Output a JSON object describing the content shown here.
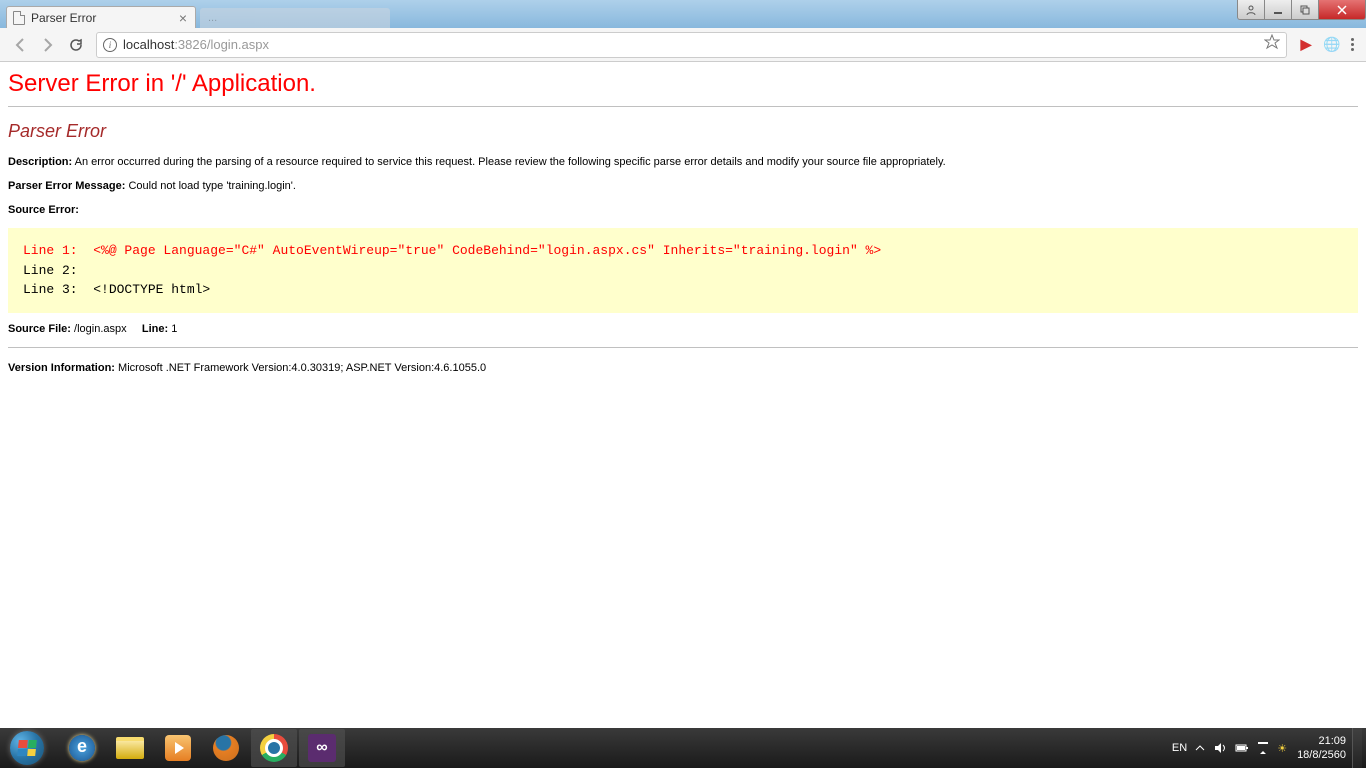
{
  "browser": {
    "active_tab_title": "Parser Error",
    "inactive_tab_title": "...",
    "url_host": "localhost",
    "url_path": ":3826/login.aspx"
  },
  "page": {
    "h1": "Server Error in '/' Application.",
    "h2": "Parser Error",
    "description_label": "Description:",
    "description_text": "An error occurred during the parsing of a resource required to service this request. Please review the following specific parse error details and modify your source file appropriately.",
    "parser_msg_label": "Parser Error Message:",
    "parser_msg_text": "Could not load type 'training.login'.",
    "source_error_label": "Source Error:",
    "source_lines": {
      "l1_label": "Line 1:  ",
      "l1_code": "<%@ Page Language=\"C#\" AutoEventWireup=\"true\" CodeBehind=\"login.aspx.cs\" Inherits=\"training.login\" %>",
      "l2": "Line 2:  ",
      "l3": "Line 3:  <!DOCTYPE html>"
    },
    "source_file_label": "Source File:",
    "source_file_value": "/login.aspx",
    "line_label": "Line:",
    "line_value": "1",
    "version_label": "Version Information:",
    "version_text": "Microsoft .NET Framework Version:4.0.30319; ASP.NET Version:4.6.1055.0"
  },
  "taskbar": {
    "lang": "EN",
    "time": "21:09",
    "date": "18/8/2560"
  }
}
